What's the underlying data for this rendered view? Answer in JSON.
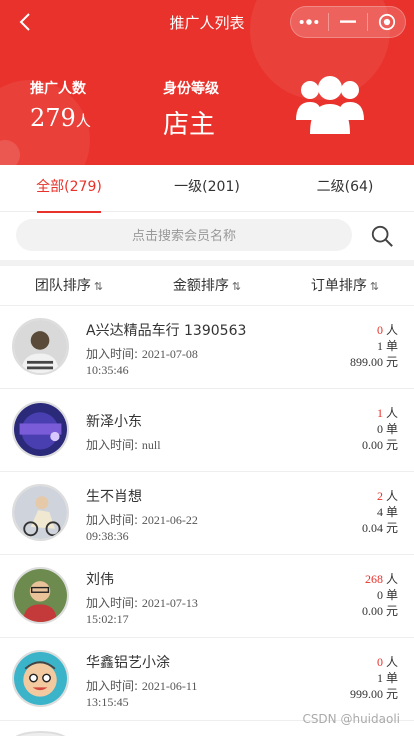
{
  "nav": {
    "title": "推广人列表"
  },
  "stats": {
    "count_label": "推广人数",
    "count_value": "279",
    "count_unit": "人",
    "level_label": "身份等级",
    "level_value": "店主"
  },
  "tabs": [
    {
      "label": "全部(279)",
      "active": true
    },
    {
      "label": "一级(201)",
      "active": false
    },
    {
      "label": "二级(64)",
      "active": false
    }
  ],
  "search": {
    "placeholder": "点击搜索会员名称"
  },
  "sorts": [
    {
      "label": "团队排序",
      "arrows": "⇅"
    },
    {
      "label": "金额排序",
      "arrows": "⇅"
    },
    {
      "label": "订单排序",
      "arrows": "⇅"
    }
  ],
  "join_label": "加入时间: ",
  "members": [
    {
      "name": "A兴达精品车行 1390563",
      "join_date": "2021-07-08",
      "join_time": "10:35:46",
      "people": "0",
      "people_unit": "人",
      "orders": "1",
      "order_unit": "单",
      "amount": "899.00",
      "amount_unit": "元"
    },
    {
      "name": "新泽小东",
      "join_date": "null",
      "join_time": "",
      "people": "1",
      "people_unit": "人",
      "orders": "0",
      "order_unit": "单",
      "amount": "0.00",
      "amount_unit": "元"
    },
    {
      "name": "生不肖想",
      "join_date": "2021-06-22",
      "join_time": "09:38:36",
      "people": "2",
      "people_unit": "人",
      "orders": "4",
      "order_unit": "单",
      "amount": "0.04",
      "amount_unit": "元"
    },
    {
      "name": "刘伟",
      "join_date": "2021-07-13",
      "join_time": "15:02:17",
      "people": "268",
      "people_unit": "人",
      "orders": "0",
      "order_unit": "单",
      "amount": "0.00",
      "amount_unit": "元"
    },
    {
      "name": "华鑫铝艺小涂",
      "join_date": "2021-06-11",
      "join_time": "13:15:45",
      "people": "0",
      "people_unit": "人",
      "orders": "1",
      "order_unit": "单",
      "amount": "999.00",
      "amount_unit": "元"
    }
  ],
  "watermark": "CSDN @huidaoli",
  "colors": {
    "brand": "#e8322b",
    "people_count": "#e8322b"
  },
  "icons": [
    "back-arrow-icon",
    "more-dots-icon",
    "minimize-icon",
    "close-target-icon",
    "people-group-icon",
    "search-icon",
    "sort-arrows-icon"
  ]
}
